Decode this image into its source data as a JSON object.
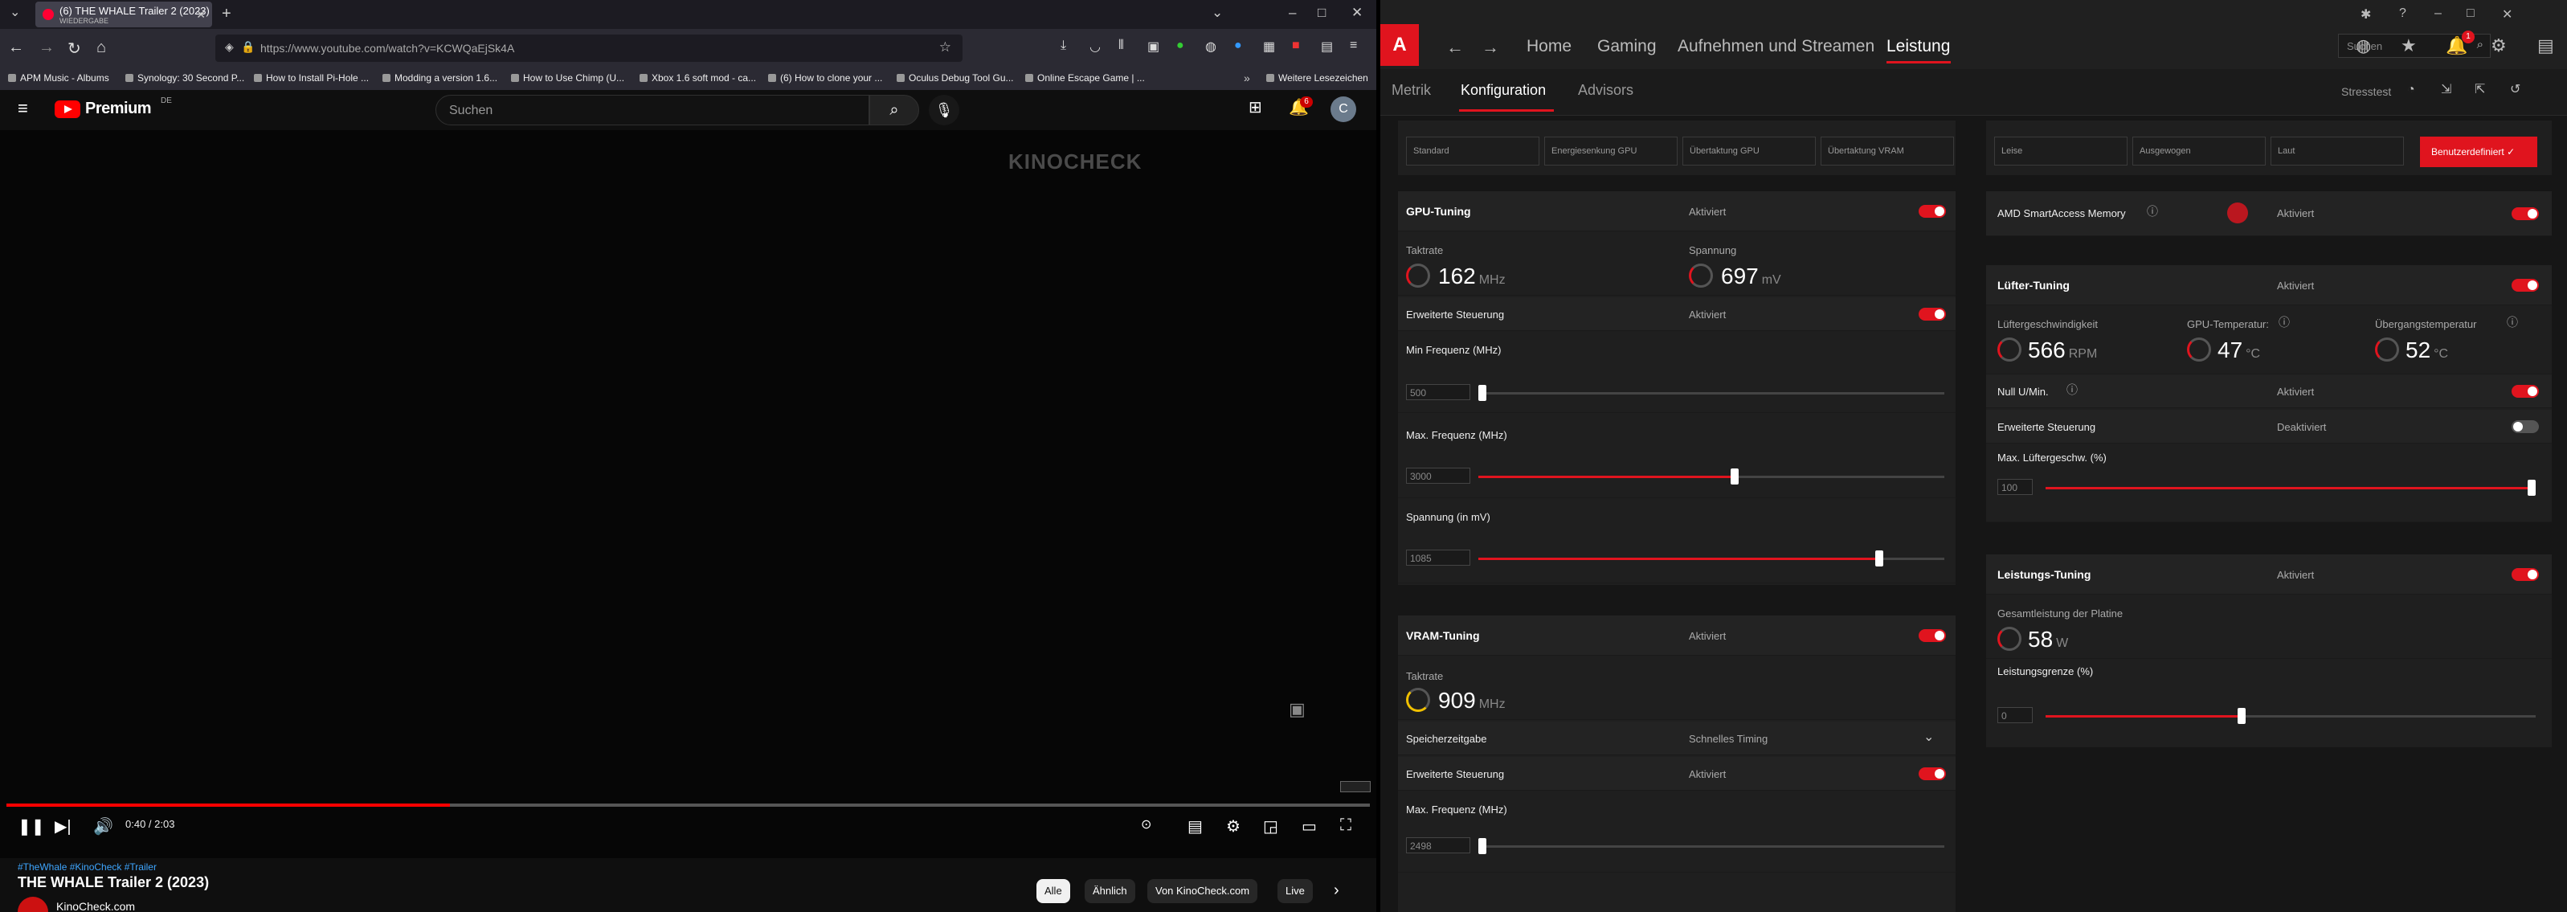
{
  "browser": {
    "tab_title": "(6) THE WHALE Trailer 2 (2023)",
    "tab_subtitle": "WIEDERGABE",
    "url": "https://www.youtube.com/watch?v=KCWQaEjSk4A",
    "bookmarks": [
      "APM Music - Albums",
      "Synology: 30 Second P...",
      "How to Install Pi-Hole ...",
      "Modding a version 1.6...",
      "How to Use Chimp (U...",
      "Xbox 1.6 soft mod - ca...",
      "(6) How to clone your ...",
      "Oculus Debug Tool Gu...",
      "Online Escape Game | ..."
    ],
    "bookmarks_more": "Weitere Lesezeichen"
  },
  "youtube": {
    "logo_text": "Premium",
    "logo_region": "DE",
    "search_placeholder": "Suchen",
    "notification_count": "6",
    "avatar_letter": "C",
    "watermark": "KINOCHECK",
    "time": "0:40 / 2:03",
    "progress": 0.325,
    "tags": "#TheWhale #KinoCheck #Trailer",
    "title": "THE WHALE Trailer 2 (2023)",
    "channel": "KinoCheck.com",
    "chips": [
      "Alle",
      "Ähnlich",
      "Von KinoCheck.com",
      "Live"
    ]
  },
  "amd": {
    "nav": [
      "Home",
      "Gaming",
      "Aufnehmen und Streamen",
      "Leistung"
    ],
    "search_placeholder": "Suchen",
    "notification_count": "1",
    "subtabs": [
      "Metrik",
      "Konfiguration",
      "Advisors"
    ],
    "stresstest": "Stresstest",
    "tuning_presets": [
      "Standard",
      "Energiesenkung GPU",
      "Übertaktung GPU",
      "Übertaktung VRAM"
    ],
    "fan_presets": [
      "Leise",
      "Ausgewogen",
      "Laut"
    ],
    "custom_preset": "Benutzerdefiniert",
    "gpu_tuning": {
      "title": "GPU-Tuning",
      "status": "Aktiviert",
      "clock_label": "Taktrate",
      "clock_value": "162",
      "clock_unit": "MHz",
      "voltage_label": "Spannung",
      "voltage_value": "697",
      "voltage_unit": "mV",
      "adv_label": "Erweiterte Steuerung",
      "adv_status": "Aktiviert",
      "min_freq_label": "Min Frequenz (MHz)",
      "min_freq_value": "500",
      "min_freq_pos": 0.0,
      "max_freq_label": "Max. Frequenz (MHz)",
      "max_freq_value": "3000",
      "max_freq_pos": 0.55,
      "volt_label": "Spannung (in mV)",
      "volt_value": "1085",
      "volt_pos": 0.86
    },
    "vram_tuning": {
      "title": "VRAM-Tuning",
      "status": "Aktiviert",
      "clock_label": "Taktrate",
      "clock_value": "909",
      "clock_unit": "MHz",
      "timing_label": "Speicherzeitgabe",
      "timing_value": "Schnelles Timing",
      "adv_label": "Erweiterte Steuerung",
      "adv_status": "Aktiviert",
      "max_freq_label": "Max. Frequenz (MHz)",
      "max_freq_value": "2498",
      "max_freq_pos": 0.0
    },
    "sam": {
      "label": "AMD SmartAccess Memory",
      "status": "Aktiviert"
    },
    "fan_tuning": {
      "title": "Lüfter-Tuning",
      "status": "Aktiviert",
      "speed_label": "Lüftergeschwindigkeit",
      "speed_value": "566",
      "speed_unit": "RPM",
      "gpu_temp_label": "GPU-Temperatur:",
      "gpu_temp_value": "47",
      "gpu_temp_unit": "°C",
      "junction_label": "Übergangstemperatur",
      "junction_value": "52",
      "junction_unit": "°C",
      "zero_rpm_label": "Null U/Min.",
      "zero_rpm_status": "Aktiviert",
      "adv_label": "Erweiterte Steuerung",
      "adv_status": "Deaktiviert",
      "max_speed_label": "Max. Lüftergeschw. (%)",
      "max_speed_value": "100",
      "max_speed_pos": 1.0
    },
    "power_tuning": {
      "title": "Leistungs-Tuning",
      "status": "Aktiviert",
      "board_power_label": "Gesamtleistung der Platine",
      "board_power_value": "58",
      "board_power_unit": "W",
      "limit_label": "Leistungsgrenze (%)",
      "limit_value": "0",
      "limit_pos": 0.4
    }
  }
}
